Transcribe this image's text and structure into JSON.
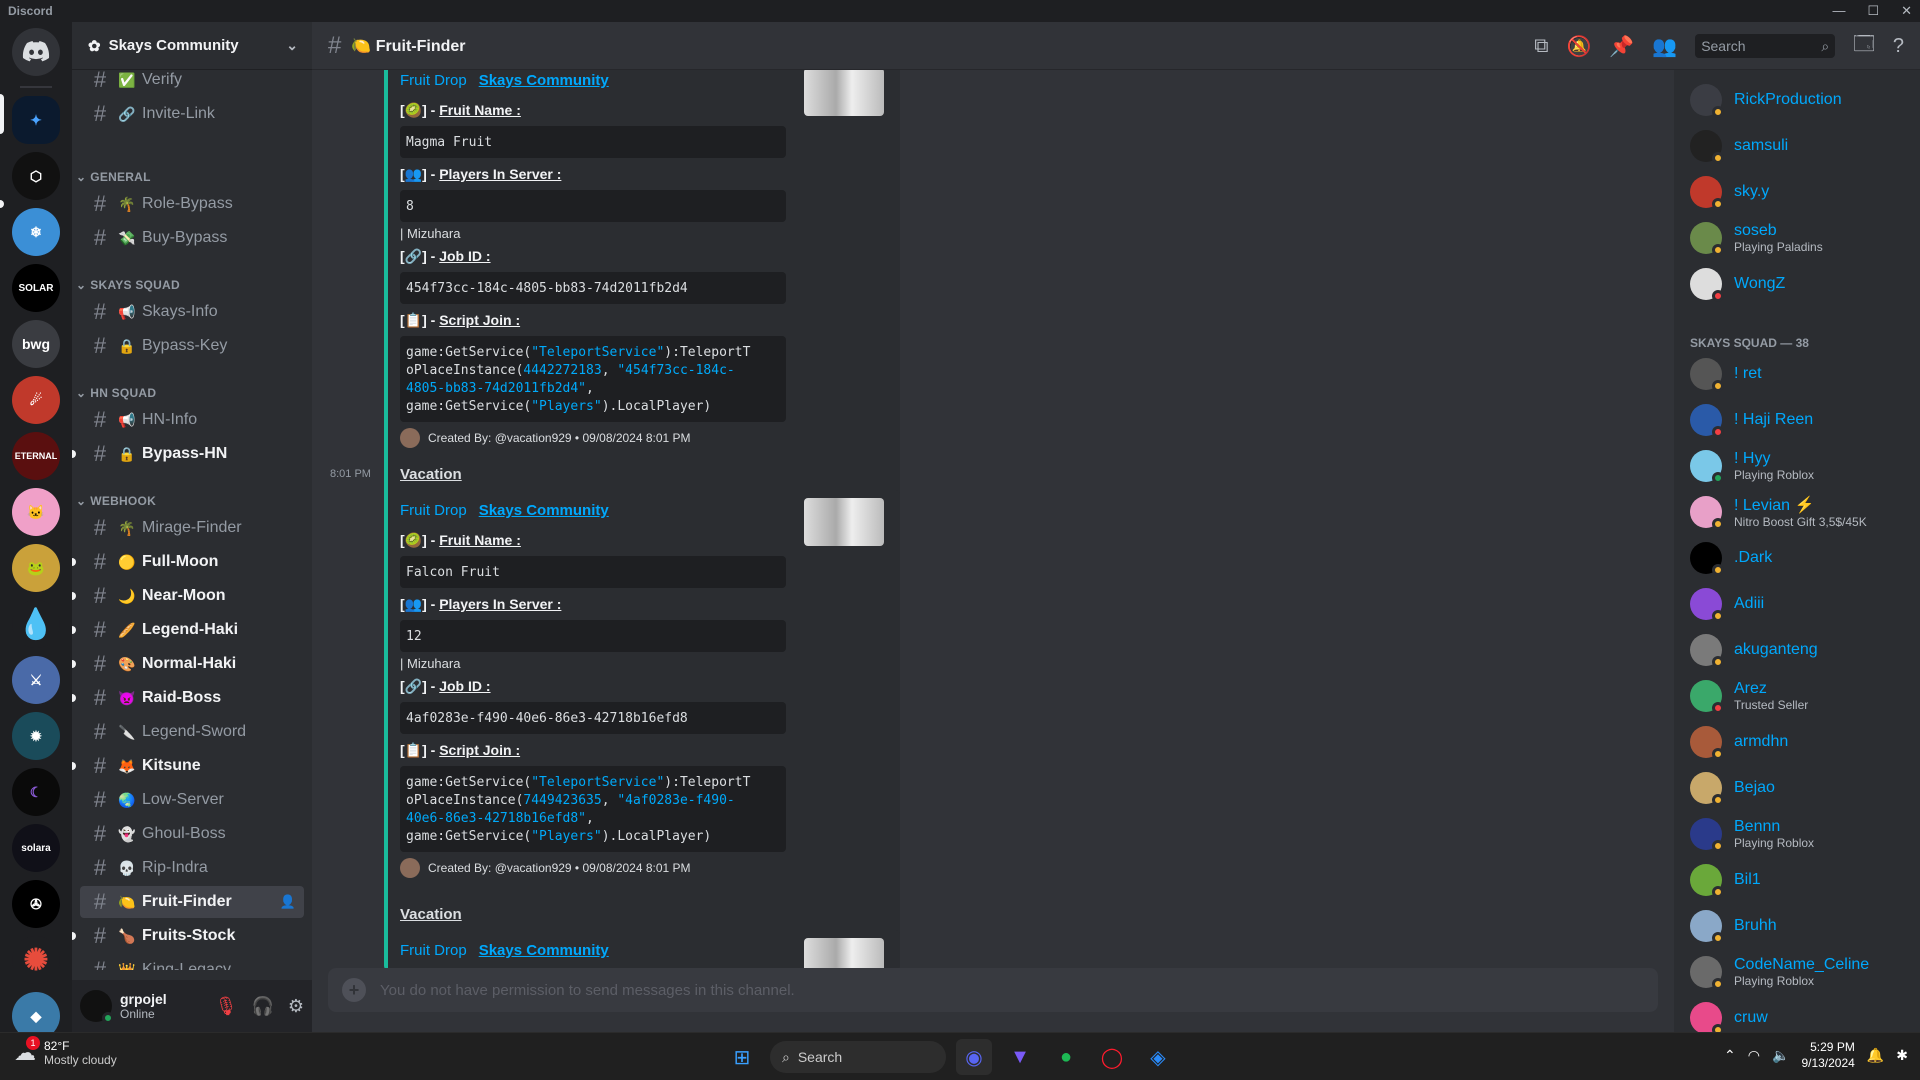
{
  "app": {
    "title": "Discord"
  },
  "server": {
    "name": "Skays Community"
  },
  "channels": {
    "top": [
      {
        "emoji": "✅",
        "label": "Verify"
      },
      {
        "emoji": "🔗",
        "label": "Invite-Link"
      }
    ],
    "categories": [
      {
        "label": "GENERAL",
        "items": [
          {
            "emoji": "🌴",
            "label": "Role-Bypass"
          },
          {
            "emoji": "💸",
            "label": "Buy-Bypass"
          }
        ]
      },
      {
        "label": "SKAYS SQUAD",
        "items": [
          {
            "emoji": "📢",
            "label": "Skays-Info"
          },
          {
            "emoji": "🔒",
            "label": "Bypass-Key"
          }
        ]
      },
      {
        "label": "HN SQUAD",
        "items": [
          {
            "emoji": "📢",
            "label": "HN-Info"
          },
          {
            "emoji": "🔒",
            "label": "Bypass-HN"
          }
        ]
      },
      {
        "label": "WEBHOOK",
        "items": [
          {
            "emoji": "🌴",
            "label": "Mirage-Finder"
          },
          {
            "emoji": "🟡",
            "label": "Full-Moon"
          },
          {
            "emoji": "🌙",
            "label": "Near-Moon"
          },
          {
            "emoji": "🥖",
            "label": "Legend-Haki"
          },
          {
            "emoji": "🎨",
            "label": "Normal-Haki"
          },
          {
            "emoji": "👿",
            "label": "Raid-Boss"
          },
          {
            "emoji": "🔪",
            "label": "Legend-Sword"
          },
          {
            "emoji": "🦊",
            "label": "Kitsune"
          },
          {
            "emoji": "🌏",
            "label": "Low-Server"
          },
          {
            "emoji": "👻",
            "label": "Ghoul-Boss"
          },
          {
            "emoji": "💀",
            "label": "Rip-Indra"
          },
          {
            "emoji": "🍋",
            "label": "Fruit-Finder"
          },
          {
            "emoji": "🍗",
            "label": "Fruits-Stock"
          },
          {
            "emoji": "👑",
            "label": "King-Legacy"
          }
        ]
      }
    ]
  },
  "user": {
    "name": "grpojel",
    "status": "Online"
  },
  "header": {
    "channel": "🍋 Fruit-Finder",
    "search_placeholder": "Search"
  },
  "messages": [
    {
      "author_title": "Fruit Drop",
      "author_link": "Skays Community",
      "f_fruit": "Fruit Name :",
      "fruit": "Magma Fruit",
      "f_players": "Players In Server :",
      "players": "8",
      "note": "| Mizuhara",
      "f_job": "Job ID :",
      "job": "454f73cc-184c-4805-bb83-74d2011fb2d4",
      "f_script": "Script Join :",
      "script_a": "game:GetService(",
      "script_svc": "\"TeleportService\"",
      "script_b": "):TeleportT",
      "script_c": "oPlaceInstance(",
      "script_place": "4442272183",
      "script_job1": "\"454f73cc-184c-",
      "script_job2": "4805-bb83-74d2011fb2d4\"",
      "script_d": "game:GetService(",
      "script_pl": "\"Players\"",
      "script_e": ").LocalPlayer)",
      "footer": "Created By: @vacation929 • 09/08/2024 8:01 PM"
    },
    {
      "username": "Vacation",
      "time": "8:01 PM",
      "author_title": "Fruit Drop",
      "author_link": "Skays Community",
      "f_fruit": "Fruit Name :",
      "fruit": "Falcon Fruit",
      "f_players": "Players In Server :",
      "players": "12",
      "note": "| Mizuhara",
      "f_job": "Job ID :",
      "job": "4af0283e-f490-40e6-86e3-42718b16efd8",
      "f_script": "Script Join :",
      "script_a": "game:GetService(",
      "script_svc": "\"TeleportService\"",
      "script_b": "):TeleportT",
      "script_c": "oPlaceInstance(",
      "script_place": "7449423635",
      "script_job1": "\"4af0283e-f490-",
      "script_job2": "40e6-86e3-42718b16efd8\"",
      "script_d": "game:GetService(",
      "script_pl": "\"Players\"",
      "script_e": ").LocalPlayer)",
      "footer": "Created By: @vacation929 • 09/08/2024 8:01 PM"
    },
    {
      "username": "Vacation",
      "author_title": "Fruit Drop",
      "author_link": "Skays Community"
    }
  ],
  "input": {
    "placeholder": "You do not have permission to send messages in this channel."
  },
  "members": {
    "top": [
      {
        "name": "RickProduction",
        "sub": ""
      },
      {
        "name": "samsuli",
        "sub": ""
      },
      {
        "name": "sky.y",
        "sub": ""
      },
      {
        "name": "soseb",
        "sub": "Playing Paladins"
      },
      {
        "name": "WongZ",
        "sub": ""
      }
    ],
    "group_label": "SKAYS SQUAD — 38",
    "squad": [
      {
        "name": "! ret",
        "sub": ""
      },
      {
        "name": "! Haji Reen",
        "sub": ""
      },
      {
        "name": "! Hyy",
        "sub": "Playing Roblox"
      },
      {
        "name": "! Levian",
        "sub": "Nitro Boost Gift 3,5$/45K"
      },
      {
        "name": ".Dark",
        "sub": ""
      },
      {
        "name": "Adiii",
        "sub": ""
      },
      {
        "name": "akuganteng",
        "sub": ""
      },
      {
        "name": "Arez",
        "sub": "Trusted Seller"
      },
      {
        "name": "armdhn",
        "sub": ""
      },
      {
        "name": "Bejao",
        "sub": ""
      },
      {
        "name": "Bennn",
        "sub": "Playing Roblox"
      },
      {
        "name": "Bil1",
        "sub": ""
      },
      {
        "name": "Bruhh",
        "sub": ""
      },
      {
        "name": "CodeName_Celine",
        "sub": "Playing Roblox"
      },
      {
        "name": "cruw",
        "sub": ""
      }
    ]
  },
  "rail": {
    "server_label": "bwg"
  },
  "taskbar": {
    "temp": "82°F",
    "weather": "Mostly cloudy",
    "badge": "1",
    "search": "Search",
    "time": "5:29 PM",
    "date": "9/13/2024"
  },
  "colors": {
    "accent": "#00a8fc",
    "embed_bar": "#1abc9c",
    "online": "#23a55a",
    "idle": "#f0b232",
    "dnd": "#f23f43"
  }
}
